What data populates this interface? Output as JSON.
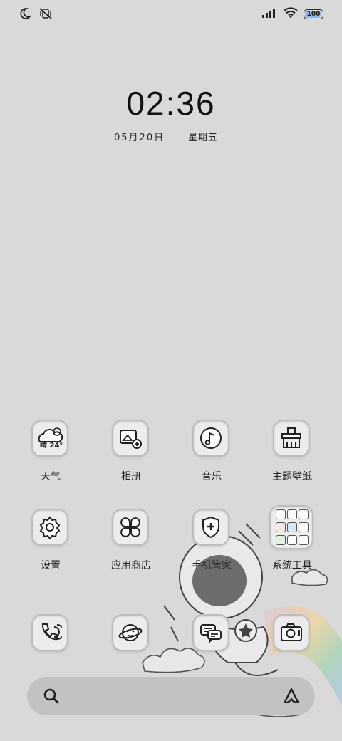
{
  "status_bar": {
    "left_icons": [
      "moon-icon",
      "vibrate-off-icon"
    ],
    "right_icons": [
      "signal-icon",
      "wifi-icon",
      "battery-icon"
    ],
    "battery_level": "100"
  },
  "lockscreen": {
    "time": "02:36",
    "date": "05月20日",
    "weekday": "星期五"
  },
  "apps": [
    {
      "label": "天气",
      "icon": "weather-icon",
      "badge": "晴 24°"
    },
    {
      "label": "相册",
      "icon": "gallery-icon"
    },
    {
      "label": "音乐",
      "icon": "music-icon"
    },
    {
      "label": "主题壁纸",
      "icon": "theme-icon"
    },
    {
      "label": "设置",
      "icon": "gear-icon"
    },
    {
      "label": "应用商店",
      "icon": "clover-icon"
    },
    {
      "label": "手机管家",
      "icon": "shield-icon"
    },
    {
      "label": "系统工具",
      "icon": "folder-icon"
    }
  ],
  "dock": {
    "apps": [
      {
        "icon": "phone-icon"
      },
      {
        "icon": "browser-icon"
      },
      {
        "icon": "messages-icon"
      },
      {
        "icon": "camera-icon"
      }
    ],
    "search_icon": "search-icon",
    "assistant_icon": "assistant-icon"
  }
}
